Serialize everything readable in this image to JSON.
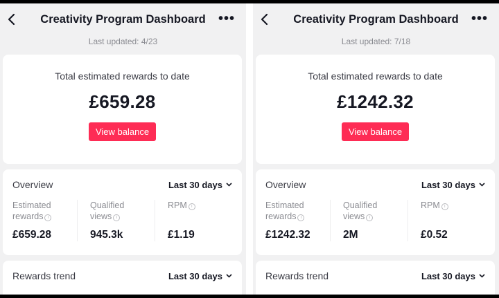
{
  "screens": [
    {
      "title": "Creativity Program Dashboard",
      "updated": "Last updated: 4/23",
      "rewards_label": "Total estimated rewards to date",
      "rewards_amount": "£659.28",
      "view_balance": "View balance",
      "overview_label": "Overview",
      "range": "Last 30 days",
      "metrics": [
        {
          "label1": "Estimated",
          "label2": "rewards",
          "value": "£659.28"
        },
        {
          "label1": "Qualified",
          "label2": "views",
          "value": "945.3k"
        },
        {
          "label1": "RPM",
          "label2": "",
          "value": "£1.19"
        }
      ],
      "trend_label": "Rewards trend",
      "trend_range": "Last 30 days"
    },
    {
      "title": "Creativity Program Dashboard",
      "updated": "Last updated: 7/18",
      "rewards_label": "Total estimated rewards to date",
      "rewards_amount": "£1242.32",
      "view_balance": "View balance",
      "overview_label": "Overview",
      "range": "Last 30 days",
      "metrics": [
        {
          "label1": "Estimated",
          "label2": "rewards",
          "value": "£1242.32"
        },
        {
          "label1": "Qualified",
          "label2": "views",
          "value": "2M"
        },
        {
          "label1": "RPM",
          "label2": "",
          "value": "£0.52"
        }
      ],
      "trend_label": "Rewards trend",
      "trend_range": "Last 30 days"
    }
  ],
  "icons": {
    "back": "chevron-left-icon",
    "more": "more-dots-icon",
    "dropdown": "chevron-down-icon",
    "info": "info-icon"
  },
  "colors": {
    "accent": "#fe2c55",
    "background": "#f1f1f2"
  }
}
